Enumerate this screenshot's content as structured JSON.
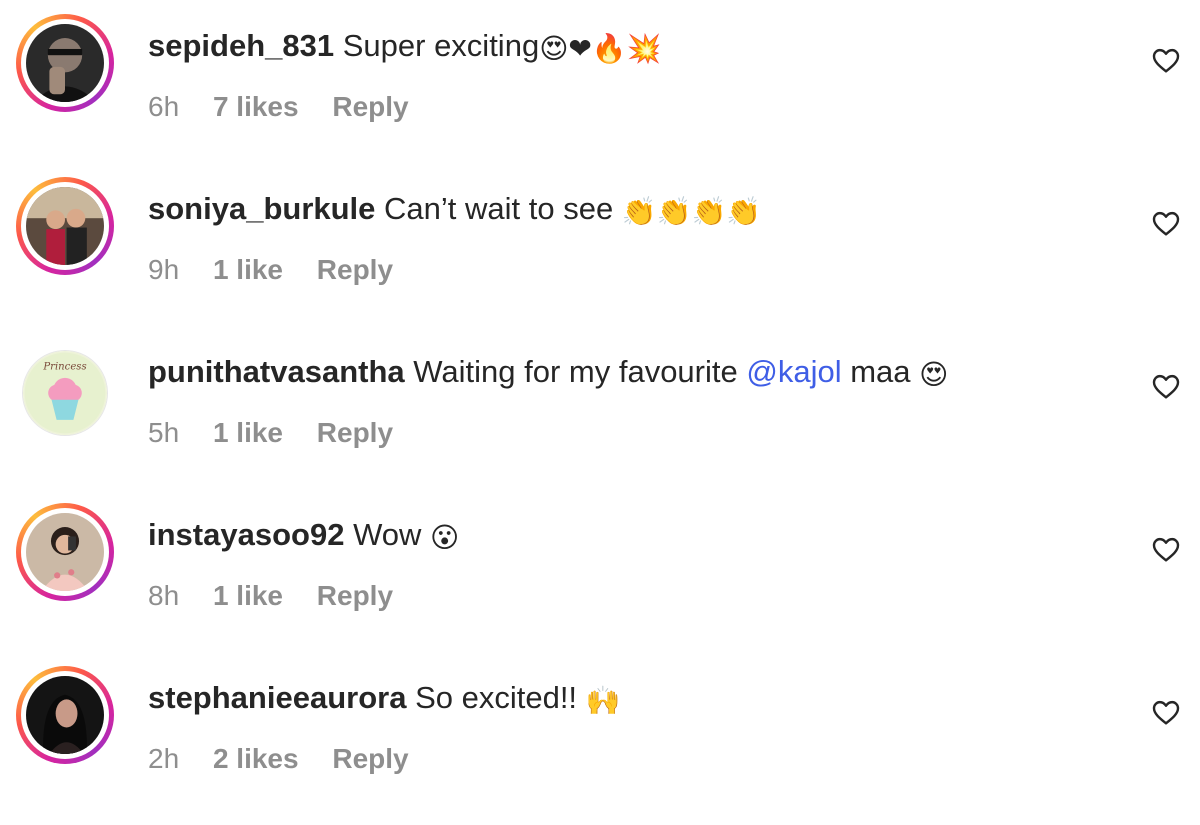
{
  "comments": [
    {
      "username": "sepideh_831",
      "text": "Super exciting",
      "emoji": "😍❤🔥💥",
      "time": "6h",
      "likes": "7 likes",
      "reply": "Reply"
    },
    {
      "username": "soniya_burkule",
      "text": "Can’t wait to see",
      "emoji": "👏👏👏👏",
      "time": "9h",
      "likes": "1 like",
      "reply": "Reply"
    },
    {
      "username": "punithatvasantha",
      "text_before": "Waiting for my favourite",
      "mention": "@kajol",
      "text_after": "maa",
      "emoji": "😍",
      "time": "5h",
      "likes": "1 like",
      "reply": "Reply"
    },
    {
      "username": "instayasoo92",
      "text": "Wow",
      "emoji": "😮",
      "time": "8h",
      "likes": "1 like",
      "reply": "Reply"
    },
    {
      "username": "stephanieeaurora",
      "text": "So excited!!",
      "emoji": "🙌",
      "time": "2h",
      "likes": "2 likes",
      "reply": "Reply"
    }
  ],
  "icons": {
    "like": "heart-outline-icon"
  },
  "avatar_text": {
    "punithatvasantha": "Princess"
  },
  "colors": {
    "mention": "#3f5ee6",
    "meta": "#8e8e8e",
    "text": "#262626"
  }
}
